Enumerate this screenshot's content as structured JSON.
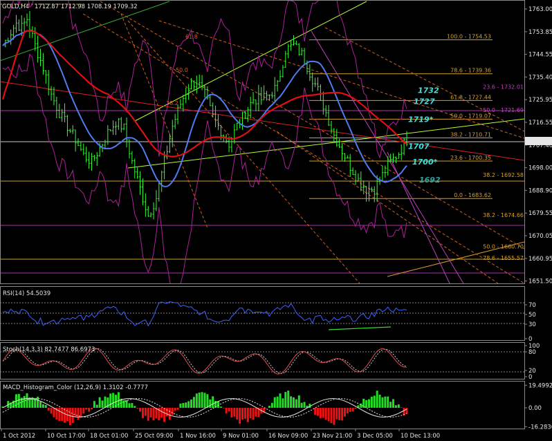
{
  "window": {
    "symbol_header": "GOLD,H4",
    "ohlc_header": "1712.87 1712.98 1708.19 1709.32"
  },
  "colors": {
    "background": "#000000",
    "grid_border": "#8a8a8a",
    "candles": "#33ff33",
    "ma_red": "#e01010",
    "ma_blue": "#4f7df0",
    "bollinger": "#b0209a",
    "trend_green": "#b8ff30",
    "fib_orange": "#d4a030",
    "fib_magenta": "#c040c0",
    "cyan_label": "#40e0e0",
    "rsi_line": "#4060ff",
    "stoch_main": "#e05050",
    "stoch_signal": "#d0d0d0",
    "macd_pos": "#22dd22",
    "macd_neg": "#ee1111"
  },
  "chart_data": [
    {
      "id": "price",
      "type": "candlestick",
      "title": "GOLD,H4",
      "ylim": [
        1646,
        1768
      ],
      "y_ticks": [
        "1763.00",
        "1753.85",
        "1744.55",
        "1735.40",
        "1725.95",
        "1716.55",
        "1707.40",
        "1698.00",
        "1688.90",
        "1679.55",
        "1670.05",
        "1660.95",
        "1651.50"
      ],
      "current_price": "1709.32",
      "close_path": [
        [
          0,
          1752
        ],
        [
          3,
          1758
        ],
        [
          5,
          1762
        ],
        [
          7,
          1760
        ],
        [
          9,
          1764
        ],
        [
          12,
          1752
        ],
        [
          15,
          1742
        ],
        [
          18,
          1730
        ],
        [
          21,
          1722
        ],
        [
          24,
          1716
        ],
        [
          27,
          1710
        ],
        [
          30,
          1703
        ],
        [
          33,
          1700
        ],
        [
          36,
          1706
        ],
        [
          39,
          1713
        ],
        [
          42,
          1718
        ],
        [
          45,
          1715
        ],
        [
          48,
          1700
        ],
        [
          51,
          1688
        ],
        [
          54,
          1676
        ],
        [
          57,
          1684
        ],
        [
          60,
          1700
        ],
        [
          63,
          1716
        ],
        [
          66,
          1726
        ],
        [
          69,
          1734
        ],
        [
          72,
          1736
        ],
        [
          75,
          1730
        ],
        [
          78,
          1720
        ],
        [
          81,
          1714
        ],
        [
          84,
          1708
        ],
        [
          87,
          1716
        ],
        [
          90,
          1722
        ],
        [
          93,
          1728
        ],
        [
          96,
          1728
        ],
        [
          99,
          1730
        ],
        [
          102,
          1734
        ],
        [
          105,
          1750
        ],
        [
          108,
          1752
        ],
        [
          111,
          1748
        ],
        [
          114,
          1740
        ],
        [
          117,
          1732
        ],
        [
          120,
          1722
        ],
        [
          123,
          1712
        ],
        [
          126,
          1705
        ],
        [
          129,
          1698
        ],
        [
          132,
          1692
        ],
        [
          135,
          1688
        ],
        [
          138,
          1688
        ],
        [
          141,
          1694
        ],
        [
          144,
          1700
        ],
        [
          147,
          1704
        ],
        [
          150,
          1710
        ]
      ],
      "fib_levels_upper": [
        {
          "label": "100.0 - 1754.53",
          "value": 1754.53
        },
        {
          "label": "78.6 - 1739.36",
          "value": 1739.36
        },
        {
          "label": "61.8 - 1727.44",
          "value": 1727.44
        },
        {
          "label": "50.0 - 1719.07",
          "value": 1719.07
        },
        {
          "label": "38.2 - 1710.71",
          "value": 1710.71
        },
        {
          "label": "23.6 - 1700.35",
          "value": 1700.35
        },
        {
          "label": "0.0 - 1683.62",
          "value": 1683.62
        }
      ],
      "fib_levels_lower": [
        {
          "label": "23.6 - 1732.01",
          "value": 1732.01
        },
        {
          "label": "50.0 - 1721.69",
          "value": 1721.69
        },
        {
          "label": "38.2 - 1692.58",
          "value": 1692.58
        },
        {
          "label": "38.2 - 1674.66",
          "value": 1674.66
        },
        {
          "label": "50.0 - 1660.70",
          "value": 1660.7
        },
        {
          "label": "78.6 - 1655.57",
          "value": 1655.57
        }
      ],
      "fan_labels": [
        "61.8",
        "50.0",
        "38.2"
      ],
      "annotations": [
        {
          "text": "1732",
          "value": 1732
        },
        {
          "text": "1727",
          "value": 1727
        },
        {
          "text": "1719*",
          "value": 1719
        },
        {
          "text": "1707",
          "value": 1707
        },
        {
          "text": "1700*",
          "value": 1700
        },
        {
          "text": "1692",
          "value": 1692
        }
      ]
    },
    {
      "id": "rsi",
      "type": "line",
      "title": "RSI(14) 54.5039",
      "ylim": [
        0,
        100
      ],
      "y_ticks": [
        "70",
        "50",
        "30",
        "0"
      ],
      "levels": [
        70,
        50,
        30
      ]
    },
    {
      "id": "stoch",
      "type": "line",
      "title": "Stoch(14,3,3) 82.7477 86.6973",
      "ylim": [
        0,
        100
      ],
      "y_ticks": [
        "100",
        "80",
        "20",
        "0"
      ],
      "levels": [
        80,
        20
      ]
    },
    {
      "id": "macd",
      "type": "bar",
      "title": "MACD_Histogram_Color (12,26,9)  1.3102 -0.7777",
      "y_ticks": [
        "19.4992",
        "0.00",
        "-16.2836"
      ],
      "ylim": [
        -16.2836,
        19.4992
      ]
    }
  ],
  "x_axis": {
    "tick_labels": [
      "1 Oct 2012",
      "10 Oct 17:00",
      "18 Oct 01:00",
      "25 Oct 09:00",
      "1 Nov 16:00",
      "9 Nov 01:00",
      "16 Nov 09:00",
      "23 Nov 21:00",
      "3 Dec 05:00",
      "10 Dec 13:00"
    ]
  }
}
